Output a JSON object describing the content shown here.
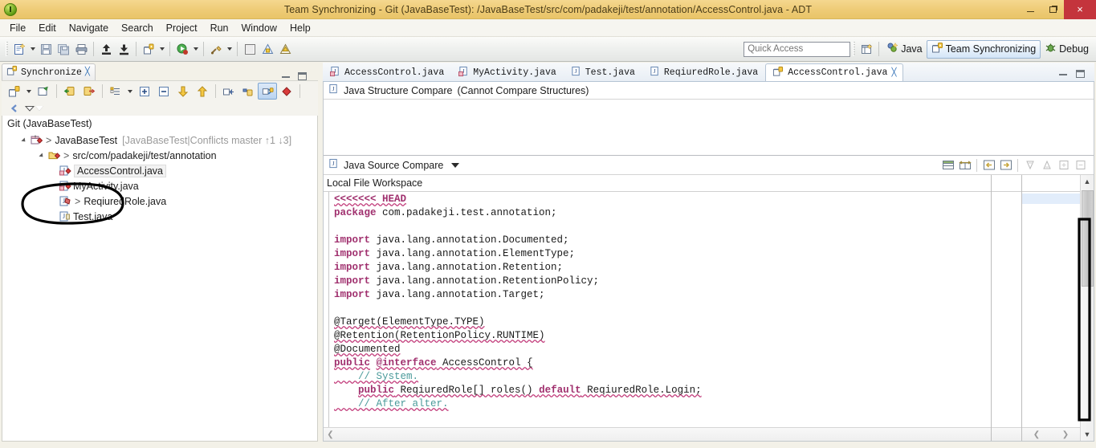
{
  "window": {
    "title": "Team Synchronizing - Git (JavaBaseTest): /JavaBaseTest/src/com/padakeji/test/annotation/AccessControl.java - ADT",
    "app_icon": "adt-icon",
    "minimize": "minimize-button",
    "maximize": "maximize-button",
    "close": "×"
  },
  "menubar": {
    "items": [
      "File",
      "Edit",
      "Navigate",
      "Search",
      "Project",
      "Run",
      "Window",
      "Help"
    ]
  },
  "toolbar": {
    "quick_access_placeholder": "Quick Access",
    "perspectives": [
      {
        "label": "Java",
        "icon": "java-perspective-icon",
        "active": false
      },
      {
        "label": "Team Synchronizing",
        "icon": "team-sync-perspective-icon",
        "active": true
      },
      {
        "label": "Debug",
        "icon": "debug-perspective-icon",
        "active": false
      }
    ],
    "open_perspective": "open-perspective-icon"
  },
  "sync_view": {
    "tab_label": "Synchronize",
    "tab_icon": "synchronize-icon",
    "close_label": "╳",
    "root_label": "Git (JavaBaseTest)",
    "tree": [
      {
        "label": "JavaBaseTest",
        "decoration": "[JavaBaseTest|Conflicts master ↑1 ↓3]",
        "prefix": ">",
        "icon": "project-conflict-icon",
        "indent": 0,
        "expandable": true,
        "selected": false
      },
      {
        "label": "src/com/padakeji/test/annotation",
        "decoration": "",
        "prefix": ">",
        "icon": "folder-conflict-icon",
        "indent": 1,
        "expandable": true,
        "selected": false
      },
      {
        "label": "AccessControl.java",
        "decoration": "",
        "prefix": "",
        "icon": "java-conflict-icon",
        "indent": 2,
        "expandable": false,
        "selected": true
      },
      {
        "label": "MyActivity.java",
        "decoration": "",
        "prefix": "",
        "icon": "java-conflict-icon",
        "indent": 2,
        "expandable": false,
        "selected": false
      },
      {
        "label": "ReqiuredRole.java",
        "decoration": "",
        "prefix": ">",
        "icon": "java-outgoing-icon",
        "indent": 2,
        "expandable": false,
        "selected": false
      },
      {
        "label": "Test.java",
        "decoration": "",
        "prefix": "",
        "icon": "java-file-icon",
        "indent": 2,
        "expandable": false,
        "selected": false
      }
    ]
  },
  "editor": {
    "tabs": [
      {
        "label": "AccessControl.java",
        "icon": "java-error-icon",
        "active": false,
        "closable": false
      },
      {
        "label": "MyActivity.java",
        "icon": "java-error-icon",
        "active": false,
        "closable": false
      },
      {
        "label": "Test.java",
        "icon": "java-file-icon",
        "active": false,
        "closable": false
      },
      {
        "label": "ReqiuredRole.java",
        "icon": "java-file-icon",
        "active": false,
        "closable": false
      },
      {
        "label": "AccessControl.java",
        "icon": "synchronize-icon",
        "active": true,
        "closable": true
      }
    ],
    "close_glyph": "╳",
    "structure_compare": {
      "title": "Java Structure Compare",
      "status": "(Cannot Compare Structures)",
      "icon": "java-file-icon"
    },
    "source_compare": {
      "title": "Java Source Compare",
      "icon": "java-file-icon",
      "menu_arrow": "chevron-down-icon",
      "left_pane_title": "Local File Workspace",
      "toolbar_icons": [
        "two-pane-view-icon",
        "three-pane-view-icon",
        "copy-right-to-left-icon",
        "copy-left-to-right-icon",
        "next-difference-icon",
        "previous-difference-icon",
        "next-change-icon",
        "previous-change-icon"
      ]
    },
    "code_lines": [
      {
        "segments": [
          {
            "t": "<<<<<<< HEAD",
            "c": "kw wavy"
          }
        ]
      },
      {
        "segments": [
          {
            "t": "package",
            "c": "kw"
          },
          {
            "t": " com.padakeji.test.annotation;",
            "c": ""
          }
        ]
      },
      {
        "segments": [
          {
            "t": "",
            "c": ""
          }
        ]
      },
      {
        "segments": [
          {
            "t": "import",
            "c": "kw"
          },
          {
            "t": " java.lang.annotation.Documented;",
            "c": ""
          }
        ]
      },
      {
        "segments": [
          {
            "t": "import",
            "c": "kw"
          },
          {
            "t": " java.lang.annotation.ElementType;",
            "c": ""
          }
        ]
      },
      {
        "segments": [
          {
            "t": "import",
            "c": "kw"
          },
          {
            "t": " java.lang.annotation.Retention;",
            "c": ""
          }
        ]
      },
      {
        "segments": [
          {
            "t": "import",
            "c": "kw"
          },
          {
            "t": " java.lang.annotation.RetentionPolicy;",
            "c": ""
          }
        ]
      },
      {
        "segments": [
          {
            "t": "import",
            "c": "kw"
          },
          {
            "t": " java.lang.annotation.Target;",
            "c": ""
          }
        ]
      },
      {
        "segments": [
          {
            "t": "",
            "c": ""
          }
        ]
      },
      {
        "segments": [
          {
            "t": "@Target(ElementType.TYPE)",
            "c": "wavy"
          }
        ]
      },
      {
        "segments": [
          {
            "t": "@Retention(RetentionPolicy.RUNTIME)",
            "c": "wavy"
          }
        ]
      },
      {
        "segments": [
          {
            "t": "@Documented",
            "c": "wavy"
          }
        ]
      },
      {
        "segments": [
          {
            "t": "public",
            "c": "kw wavy"
          },
          {
            "t": " ",
            "c": ""
          },
          {
            "t": "@interface",
            "c": "kw wavy"
          },
          {
            "t": " AccessControl {",
            "c": "wavy"
          }
        ]
      },
      {
        "segments": [
          {
            "t": "    // System.",
            "c": "cmt wavy"
          }
        ]
      },
      {
        "segments": [
          {
            "t": "    ",
            "c": ""
          },
          {
            "t": "public",
            "c": "kw wavy"
          },
          {
            "t": " ReqiuredRole[] roles() ",
            "c": "wavy"
          },
          {
            "t": "default",
            "c": "kw wavy"
          },
          {
            "t": " ReqiuredRole.Login;",
            "c": "wavy"
          }
        ]
      },
      {
        "segments": [
          {
            "t": "    // After alter.",
            "c": "cmt wavy"
          }
        ]
      }
    ]
  },
  "annotations": [
    {
      "name": "ellipse-highlight-head-conflict",
      "shape": "ellipse"
    },
    {
      "name": "rectangle-highlight-scrollbar",
      "shape": "rectangle"
    }
  ],
  "colors": {
    "title_bg": "#eecb76",
    "close_red": "#c4343c",
    "keyword": "#a0306e",
    "comment": "#4a9a9a",
    "selection": "#e2edfb",
    "accent_tab": "#b5c4d4",
    "annotation_ink": "#000000"
  }
}
